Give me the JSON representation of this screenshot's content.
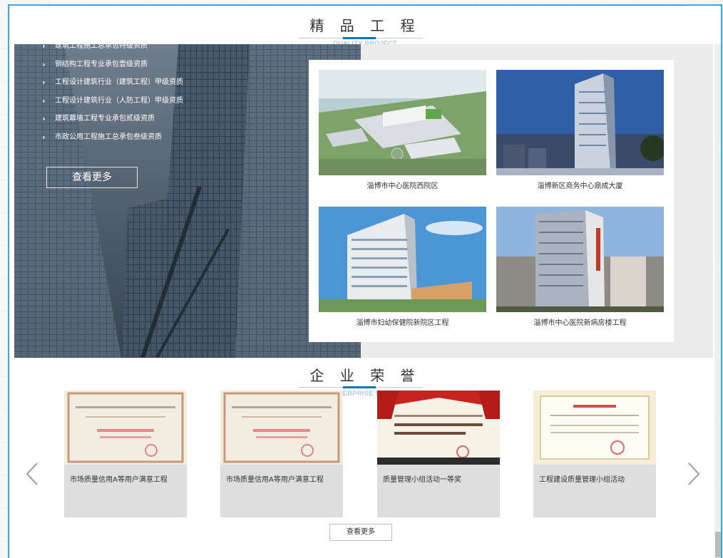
{
  "quality": {
    "title_zh": "精 品 工 程",
    "title_en": "QUALITY PROJECT",
    "qualifications": [
      "建筑工程施工总承包特级资质",
      "钢结构工程专业承包壹级资质",
      "工程设计建筑行业（建筑工程）甲级资质",
      "工程设计建筑行业（人防工程）甲级资质",
      "建筑幕墙工程专业承包贰级资质",
      "市政公用工程施工总承包叁级资质"
    ],
    "more_label": "查看更多",
    "projects": [
      {
        "caption": "淄博市中心医院西院区"
      },
      {
        "caption": "淄博新区商务中心鼎成大厦"
      },
      {
        "caption": "淄博市妇幼保健院新院区工程"
      },
      {
        "caption": "淄博市中心医院新病房楼工程"
      }
    ]
  },
  "honor": {
    "title_zh": "企 业 荣 誉",
    "title_en": "ENTERPRISE HONOR",
    "items": [
      {
        "caption": "市场质量信用A等用户满意工程"
      },
      {
        "caption": "市场质量信用A等用户满意工程"
      },
      {
        "caption": "质量管理小组活动一等奖"
      },
      {
        "caption": "工程建设质量管理小组活动"
      }
    ],
    "more_label": "查看更多",
    "prev_icon": "chevron-left-icon",
    "next_icon": "chevron-right-icon"
  },
  "colors": {
    "frame_border": "#3aa7e0",
    "title_accent": "#0d78b5",
    "english_subtitle": "#8ab4cf"
  }
}
